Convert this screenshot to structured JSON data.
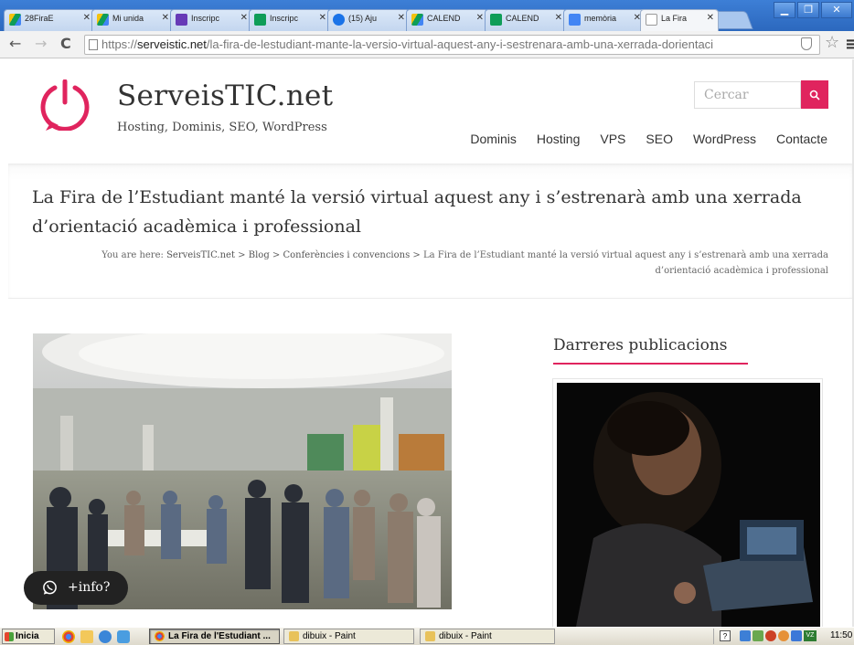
{
  "browser": {
    "tabs": [
      {
        "label": "28FiraE",
        "icon": "drive-icon"
      },
      {
        "label": "Mi unida",
        "icon": "drive-icon"
      },
      {
        "label": "Inscripc",
        "icon": "forms-icon"
      },
      {
        "label": "Inscripc",
        "icon": "sheets-plus-icon"
      },
      {
        "label": "(15) Aju",
        "icon": "circle-icon"
      },
      {
        "label": "CALEND",
        "icon": "drive-icon"
      },
      {
        "label": "CALEND",
        "icon": "sheets-plus-icon"
      },
      {
        "label": "memòria",
        "icon": "docs-icon"
      },
      {
        "label": "La Fira",
        "icon": "page-icon"
      }
    ],
    "url_scheme": "https://",
    "url_host": "serveistic.net",
    "url_path": "/la-fira-de-lestudiant-mante-la-versio-virtual-aquest-any-i-sestrenara-amb-una-xerrada-dorientaci",
    "window_controls": [
      "minimize",
      "maximize",
      "close"
    ]
  },
  "site": {
    "title": "ServeisTIC.net",
    "tagline": "Hosting, Dominis, SEO, WordPress",
    "brand_color": "#e0245e",
    "search_placeholder": "Cercar",
    "nav": [
      "Dominis",
      "Hosting",
      "VPS",
      "SEO",
      "WordPress",
      "Contacte"
    ]
  },
  "post": {
    "title": "La Fira de l’Estudiant manté la versió virtual aquest any i s’estrenarà amb una xerrada d’orientació acadèmica i professional",
    "breadcrumb_prefix": "You are here:",
    "breadcrumb": [
      "ServeisTIC.net",
      "Blog",
      "Conferències i convencions",
      "La Fira de l’Estudiant manté la versió virtual aquest any i s’estrenarà amb una xerrada d’orientació acadèmica i professional"
    ],
    "breadcrumb_separator": ">"
  },
  "sidebar": {
    "heading": "Darreres publicacions"
  },
  "whatsapp": {
    "label": "+info?"
  },
  "taskbar": {
    "start_label": "Inicia",
    "tasks": [
      {
        "label": "La Fira de l'Estudiant ...",
        "active": true
      },
      {
        "label": "dibuix - Paint",
        "active": false
      },
      {
        "label": "dibuix - Paint",
        "active": false
      }
    ],
    "clock": "11:50"
  }
}
